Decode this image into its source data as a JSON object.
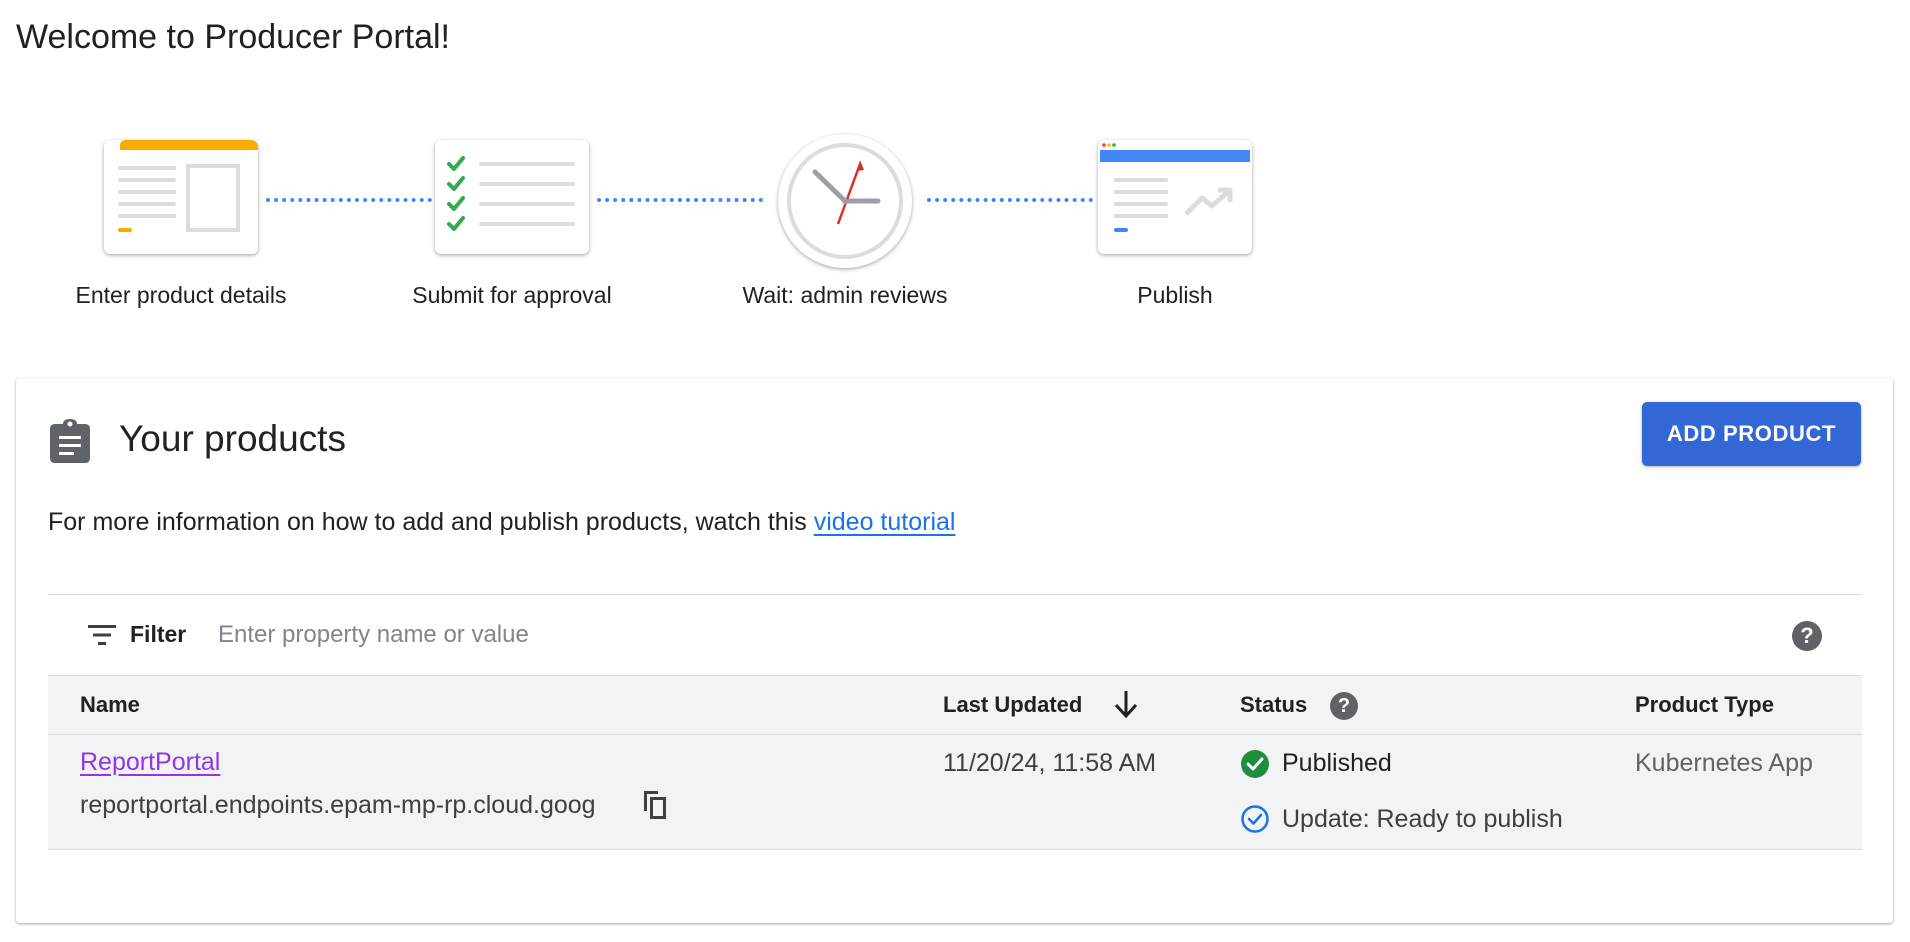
{
  "page": {
    "title": "Welcome to Producer Portal!"
  },
  "steps": [
    {
      "label": "Enter product details",
      "icon": "product-details-form-icon"
    },
    {
      "label": "Submit for approval",
      "icon": "approval-checklist-icon"
    },
    {
      "label": "Wait: admin reviews",
      "icon": "clock-icon"
    },
    {
      "label": "Publish",
      "icon": "publish-browser-chart-icon"
    }
  ],
  "colors": {
    "accent_blue": "#4285f4",
    "button_blue": "#3367d6",
    "link_blue": "#1a73e8",
    "visited_link": "#9334e6",
    "check_green": "#34a853",
    "status_green": "#1e8e3e",
    "yellow": "#f9ab00",
    "clock_hand_red": "#d93025"
  },
  "products": {
    "title": "Your products",
    "add_button": "ADD PRODUCT",
    "info_text": "For more information on how to add and publish products, watch this",
    "info_link": "video tutorial",
    "filter": {
      "label": "Filter",
      "placeholder": "Enter property name or value"
    },
    "columns": {
      "name": "Name",
      "last_updated": "Last Updated",
      "status": "Status",
      "product_type": "Product Type"
    },
    "sort": {
      "column": "last_updated",
      "direction": "descending"
    },
    "rows": [
      {
        "name": "ReportPortal",
        "endpoint": "reportportal.endpoints.epam-mp-rp.cloud.goog",
        "last_updated": "11/20/24, 11:58 AM",
        "status": "Published",
        "update_status": "Update: Ready to publish",
        "product_type": "Kubernetes App"
      }
    ]
  }
}
